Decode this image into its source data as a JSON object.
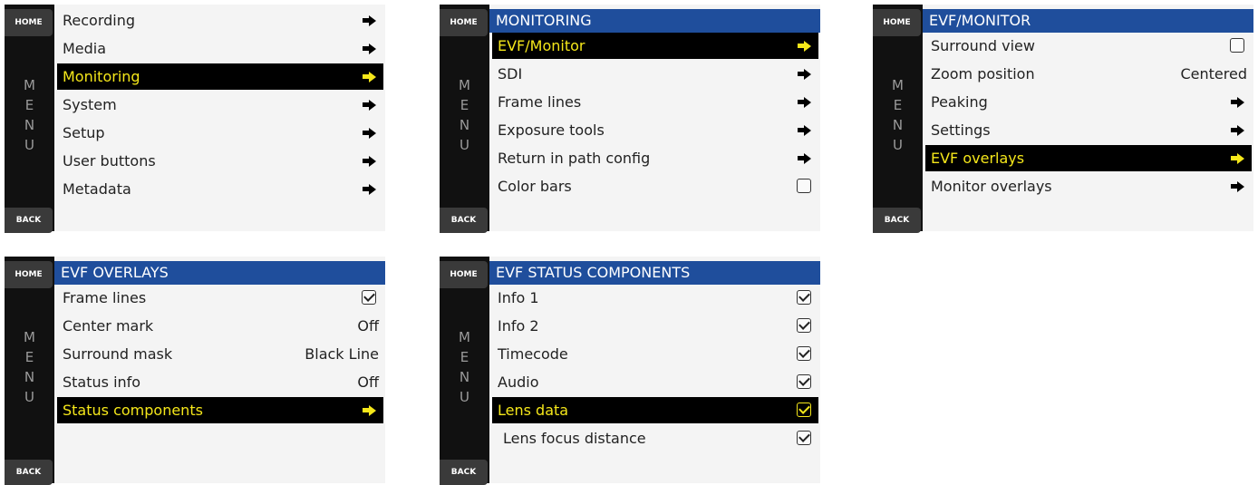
{
  "common": {
    "home_label": "HOME",
    "back_label": "BACK",
    "menu_letters": [
      "M",
      "E",
      "N",
      "U"
    ]
  },
  "panels": [
    {
      "title": "",
      "items": [
        {
          "label": "Recording",
          "type": "arrow",
          "selected": false
        },
        {
          "label": "Media",
          "type": "arrow",
          "selected": false
        },
        {
          "label": "Monitoring",
          "type": "arrow",
          "selected": true
        },
        {
          "label": "System",
          "type": "arrow",
          "selected": false
        },
        {
          "label": "Setup",
          "type": "arrow",
          "selected": false
        },
        {
          "label": "User buttons",
          "type": "arrow",
          "selected": false
        },
        {
          "label": "Metadata",
          "type": "arrow",
          "selected": false
        }
      ]
    },
    {
      "title": "MONITORING",
      "items": [
        {
          "label": "EVF/Monitor",
          "type": "arrow",
          "selected": true
        },
        {
          "label": "SDI",
          "type": "arrow",
          "selected": false
        },
        {
          "label": "Frame lines",
          "type": "arrow",
          "selected": false
        },
        {
          "label": "Exposure tools",
          "type": "arrow",
          "selected": false
        },
        {
          "label": "Return in path config",
          "type": "arrow",
          "selected": false
        },
        {
          "label": "Color bars",
          "type": "checkbox",
          "checked": false,
          "selected": false
        }
      ]
    },
    {
      "title": "EVF/MONITOR",
      "items": [
        {
          "label": "Surround view",
          "type": "checkbox",
          "checked": false,
          "selected": false
        },
        {
          "label": "Zoom position",
          "type": "value",
          "value": "Centered",
          "selected": false
        },
        {
          "label": "Peaking",
          "type": "arrow",
          "selected": false
        },
        {
          "label": "Settings",
          "type": "arrow",
          "selected": false
        },
        {
          "label": "EVF overlays",
          "type": "arrow",
          "selected": true
        },
        {
          "label": "Monitor overlays",
          "type": "arrow",
          "selected": false
        }
      ]
    },
    {
      "title": "EVF OVERLAYS",
      "items": [
        {
          "label": "Frame lines",
          "type": "checkbox",
          "checked": true,
          "selected": false
        },
        {
          "label": "Center mark",
          "type": "value",
          "value": "Off",
          "selected": false
        },
        {
          "label": "Surround mask",
          "type": "value",
          "value": "Black Line",
          "selected": false
        },
        {
          "label": "Status info",
          "type": "value",
          "value": "Off",
          "selected": false
        },
        {
          "label": "Status components",
          "type": "arrow",
          "selected": true
        }
      ]
    },
    {
      "title": "EVF STATUS COMPONENTS",
      "items": [
        {
          "label": "Info 1",
          "type": "checkbox",
          "checked": true,
          "selected": false
        },
        {
          "label": "Info 2",
          "type": "checkbox",
          "checked": true,
          "selected": false
        },
        {
          "label": "Timecode",
          "type": "checkbox",
          "checked": true,
          "selected": false
        },
        {
          "label": "Audio",
          "type": "checkbox",
          "checked": true,
          "selected": false
        },
        {
          "label": "Lens data",
          "type": "checkbox",
          "checked": true,
          "selected": true
        },
        {
          "label": "Lens focus distance",
          "type": "checkbox",
          "checked": true,
          "selected": false,
          "indent": true
        }
      ]
    }
  ],
  "colors": {
    "header_bg": "#1f4e9c",
    "selected_text": "#f5e71a",
    "selected_bg": "#000000",
    "sidebar_bg": "#111111"
  }
}
